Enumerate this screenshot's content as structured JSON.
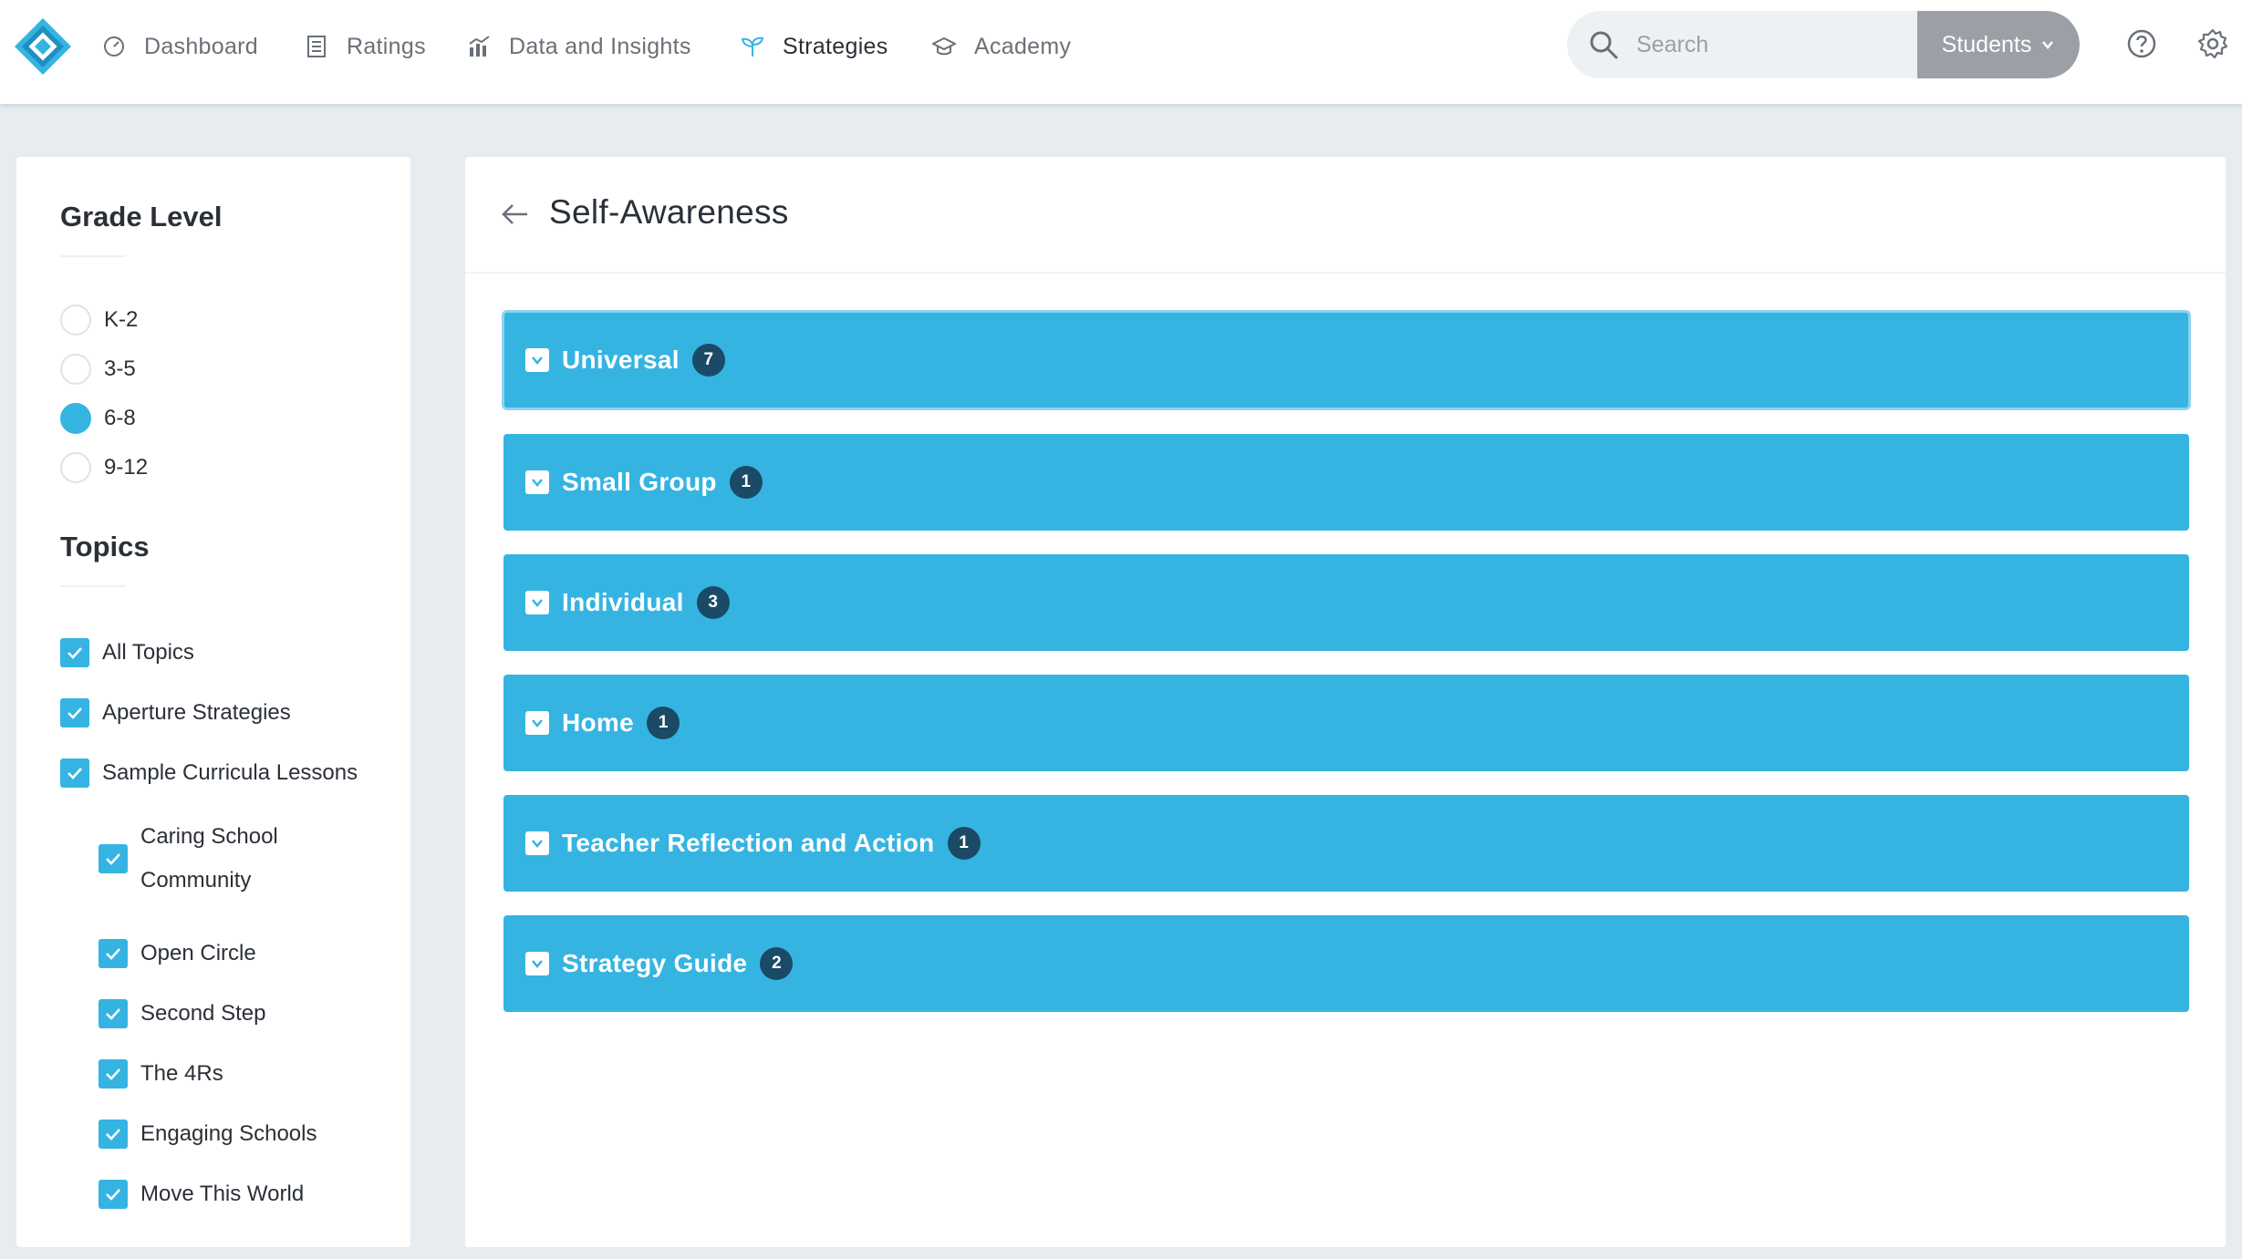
{
  "nav": {
    "items": [
      {
        "label": "Dashboard",
        "icon": "dashboard-icon"
      },
      {
        "label": "Ratings",
        "icon": "ratings-icon"
      },
      {
        "label": "Data and Insights",
        "icon": "chart-icon"
      },
      {
        "label": "Strategies",
        "icon": "sprout-icon",
        "active": true
      },
      {
        "label": "Academy",
        "icon": "graduation-cap-icon"
      }
    ],
    "search_placeholder": "Search",
    "students_label": "Students"
  },
  "sidebar": {
    "grade_heading": "Grade Level",
    "grades": [
      {
        "label": "K-2",
        "selected": false
      },
      {
        "label": "3-5",
        "selected": false
      },
      {
        "label": "6-8",
        "selected": true
      },
      {
        "label": "9-12",
        "selected": false
      }
    ],
    "topics_heading": "Topics",
    "topics": [
      {
        "label": "All Topics",
        "checked": true
      },
      {
        "label": "Aperture Strategies",
        "checked": true
      },
      {
        "label": "Sample Curricula Lessons",
        "checked": true
      }
    ],
    "subtopics": [
      {
        "label": "Caring School Community",
        "checked": true
      },
      {
        "label": "Open Circle",
        "checked": true
      },
      {
        "label": "Second Step",
        "checked": true
      },
      {
        "label": "The 4Rs",
        "checked": true
      },
      {
        "label": "Engaging Schools",
        "checked": true
      },
      {
        "label": "Move This World",
        "checked": true
      }
    ]
  },
  "main": {
    "title": "Self-Awareness",
    "sections": [
      {
        "label": "Universal",
        "count": "7"
      },
      {
        "label": "Small Group",
        "count": "1"
      },
      {
        "label": "Individual",
        "count": "3"
      },
      {
        "label": "Home",
        "count": "1"
      },
      {
        "label": "Teacher Reflection and Action",
        "count": "1"
      },
      {
        "label": "Strategy Guide",
        "count": "2"
      }
    ]
  },
  "colors": {
    "accent": "#35b4e2",
    "badge": "#1b4a66",
    "background": "#e6ecef"
  }
}
